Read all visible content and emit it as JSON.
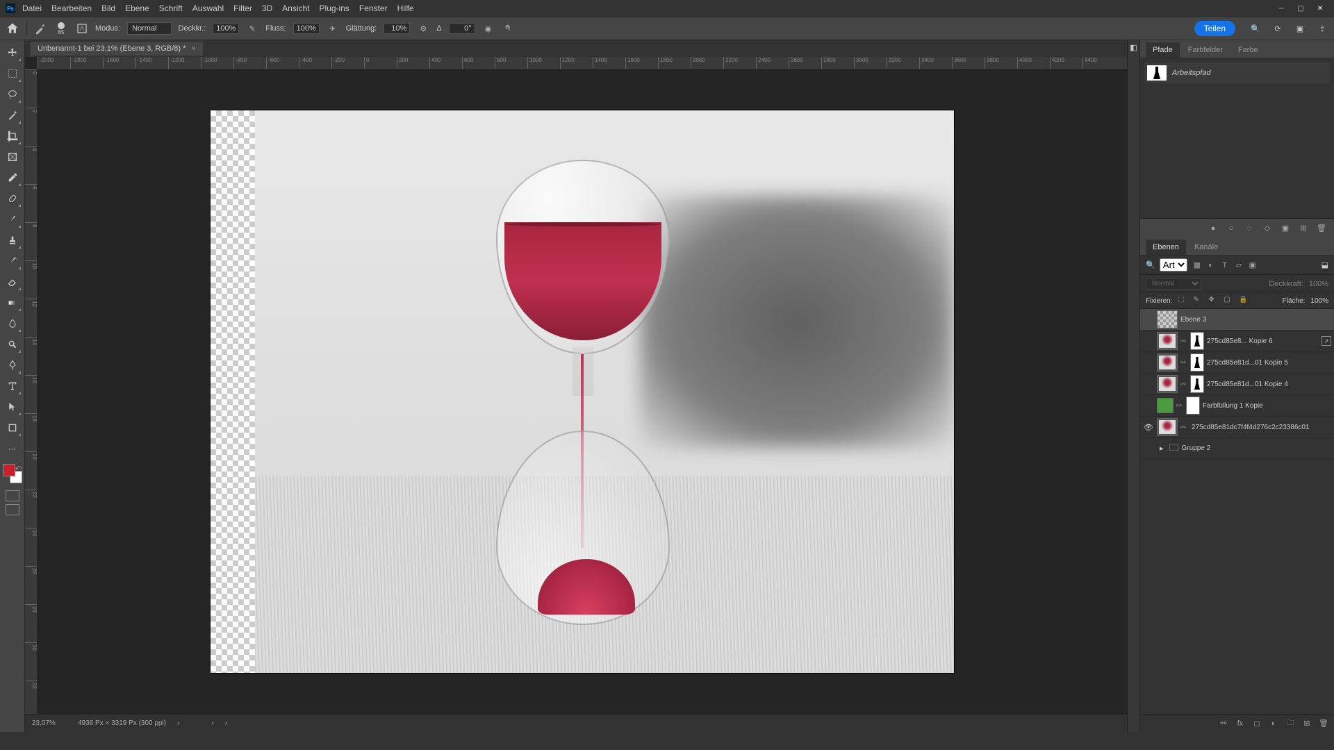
{
  "titlebar": {
    "app": "Ps"
  },
  "menu": [
    "Datei",
    "Bearbeiten",
    "Bild",
    "Ebene",
    "Schrift",
    "Auswahl",
    "Filter",
    "3D",
    "Ansicht",
    "Plug-ins",
    "Fenster",
    "Hilfe"
  ],
  "options": {
    "brush_size": "65",
    "mode_label": "Modus:",
    "mode_value": "Normal",
    "opacity_label": "Deckkr.:",
    "opacity_value": "100%",
    "flow_label": "Fluss:",
    "flow_value": "100%",
    "smooth_label": "Glättung:",
    "smooth_value": "10%",
    "angle_label": "Δ",
    "angle_value": "0°",
    "share": "Teilen"
  },
  "document": {
    "tab_title": "Unbenannt-1 bei 23,1% (Ebene 3, RGB/8) *"
  },
  "ruler_ticks_h": [
    "-2000",
    "-1800",
    "-1600",
    "-1400",
    "-1200",
    "-1000",
    "-800",
    "-600",
    "-400",
    "-200",
    "0",
    "200",
    "400",
    "600",
    "800",
    "1000",
    "1200",
    "1400",
    "1600",
    "1800",
    "2000",
    "2200",
    "2400",
    "2600",
    "2800",
    "3000",
    "3200",
    "3400",
    "3600",
    "3800",
    "4000",
    "4200",
    "4400"
  ],
  "ruler_ticks_v": [
    "0",
    "2",
    "4",
    "6",
    "8",
    "10",
    "12",
    "14",
    "16",
    "18",
    "20",
    "22",
    "24",
    "26",
    "28",
    "30",
    "32"
  ],
  "panels": {
    "paths": {
      "tabs": [
        "Pfade",
        "Farbfelder",
        "Farbe"
      ],
      "active": 0,
      "item": "Arbeitspfad"
    },
    "layers": {
      "tabs": [
        "Ebenen",
        "Kanäle"
      ],
      "active": 0,
      "filter_label": "Art",
      "blend_mode": "Normal",
      "opacity_label": "Deckkraft:",
      "opacity_value": "100%",
      "lock_label": "Fixieren:",
      "fill_label": "Fläche:",
      "fill_value": "100%",
      "items": [
        {
          "vis": false,
          "name": "Ebene 3",
          "type": "empty",
          "selected": true
        },
        {
          "vis": false,
          "name": "275cd85e8... Kopie 6",
          "type": "smart-mask",
          "badge": true
        },
        {
          "vis": false,
          "name": "275cd85e81d...01 Kopie 5",
          "type": "smart-mask"
        },
        {
          "vis": false,
          "name": "275cd85e81d...01 Kopie 4",
          "type": "smart-mask"
        },
        {
          "vis": false,
          "name": "Farbfüllung 1 Kopie",
          "type": "fill"
        },
        {
          "vis": true,
          "name": "275cd85e81dc7f4f4d276c2c23386c01",
          "type": "smart"
        },
        {
          "vis": false,
          "name": "Gruppe 2",
          "type": "group"
        }
      ]
    }
  },
  "statusbar": {
    "zoom": "23,07%",
    "info": "4936 Px × 3319 Px (300 ppi)"
  }
}
